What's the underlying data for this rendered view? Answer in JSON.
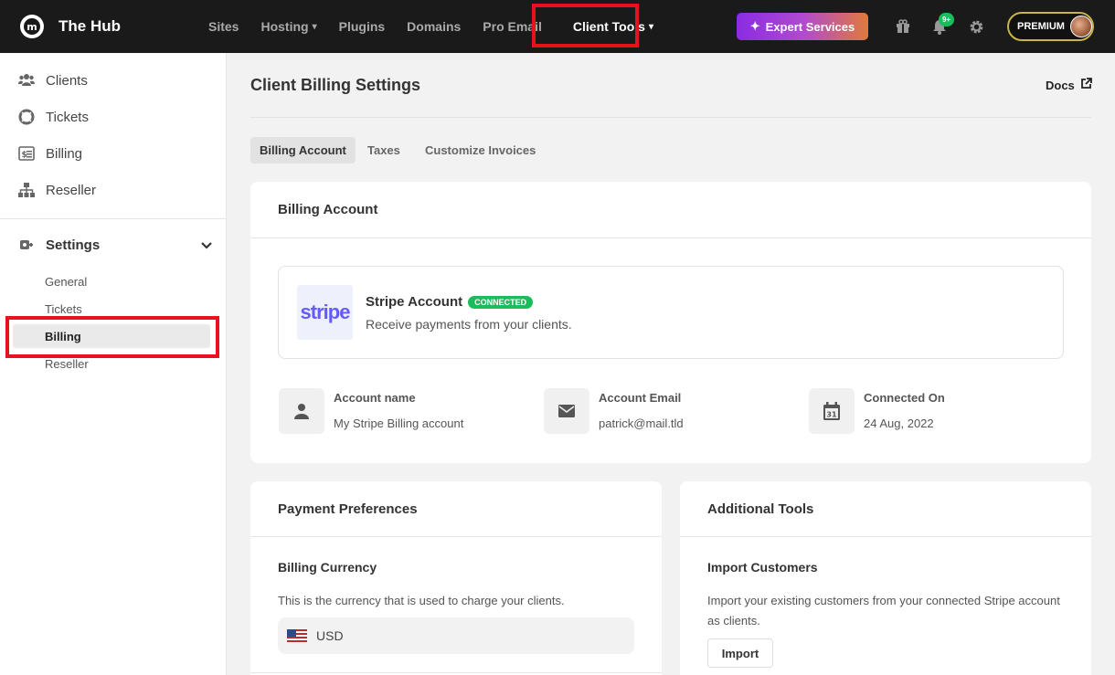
{
  "topbar": {
    "brand": "The Hub",
    "nav": [
      {
        "label": "Sites",
        "dropdown": false
      },
      {
        "label": "Hosting",
        "dropdown": true
      },
      {
        "label": "Plugins",
        "dropdown": false
      },
      {
        "label": "Domains",
        "dropdown": false
      },
      {
        "label": "Pro Email",
        "dropdown": false
      },
      {
        "label": "Client Tools",
        "dropdown": true,
        "active": true
      }
    ],
    "expert_label": "Expert Services",
    "notif_count": "9+",
    "plan_label": "PREMIUM"
  },
  "sidebar": {
    "items": [
      {
        "label": "Clients",
        "icon": "users-icon"
      },
      {
        "label": "Tickets",
        "icon": "lifebuoy-icon"
      },
      {
        "label": "Billing",
        "icon": "invoice-icon"
      },
      {
        "label": "Reseller",
        "icon": "sitemap-icon"
      }
    ],
    "settings_label": "Settings",
    "settings_sub": [
      {
        "label": "General"
      },
      {
        "label": "Tickets"
      },
      {
        "label": "Billing",
        "active": true
      },
      {
        "label": "Reseller"
      }
    ]
  },
  "main": {
    "title": "Client Billing Settings",
    "docs_label": "Docs",
    "tabs": [
      {
        "label": "Billing Account",
        "active": true
      },
      {
        "label": "Taxes"
      },
      {
        "label": "Customize Invoices"
      }
    ],
    "billing_account": {
      "title": "Billing Account",
      "stripe_logo": "stripe",
      "stripe_name": "Stripe Account",
      "status": "CONNECTED",
      "stripe_desc": "Receive payments from your clients.",
      "info": [
        {
          "label": "Account name",
          "value": "My Stripe Billing account",
          "icon": "user-icon"
        },
        {
          "label": "Account Email",
          "value": "patrick@mail.tld",
          "icon": "envelope-icon"
        },
        {
          "label": "Connected On",
          "value": "24 Aug, 2022",
          "icon": "calendar-icon",
          "icon_text": "31"
        }
      ]
    },
    "payment_prefs": {
      "title": "Payment Preferences",
      "currency_title": "Billing Currency",
      "currency_desc": "This is the currency that is used to charge your clients.",
      "currency_value": "USD"
    },
    "additional_tools": {
      "title": "Additional Tools",
      "import_title": "Import Customers",
      "import_desc": "Import your existing customers from your connected Stripe account as clients.",
      "import_button": "Import"
    }
  },
  "colors": {
    "topbar_bg": "#1a1a1a",
    "highlight_red": "#e8121c",
    "connected_green": "#1abc5c",
    "stripe_purple": "#635bff"
  }
}
